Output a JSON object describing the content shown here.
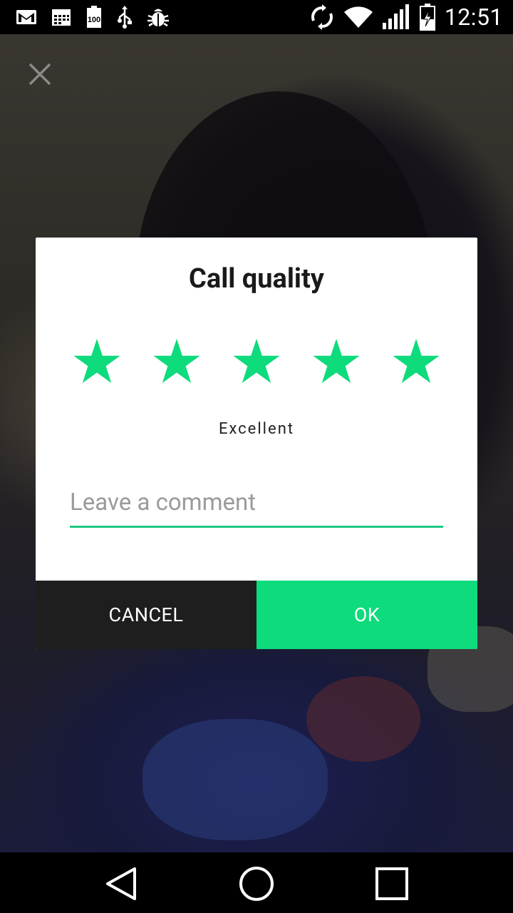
{
  "status_bar": {
    "time": "12:51",
    "left_icons": [
      "gmail-icon",
      "calendar-icon",
      "battery-100-icon",
      "usb-icon",
      "debug-icon"
    ],
    "right_icons": [
      "sync-icon",
      "wifi-icon",
      "signal-icon",
      "battery-charging-icon"
    ]
  },
  "dialog": {
    "title": "Call quality",
    "rating": {
      "value": 5,
      "max": 5
    },
    "rating_label": "Excellent",
    "comment": {
      "value": "",
      "placeholder": "Leave a comment"
    },
    "cancel_label": "CANCEL",
    "ok_label": "OK"
  },
  "colors": {
    "accent": "#0ddb7c",
    "star": "#0ddb7c",
    "underline": "#22c884",
    "cancel_bg": "#1e1e1e",
    "dialog_bg": "#ffffff"
  },
  "nav_bar": {
    "icons": [
      "back-icon",
      "home-icon",
      "recents-icon"
    ]
  }
}
